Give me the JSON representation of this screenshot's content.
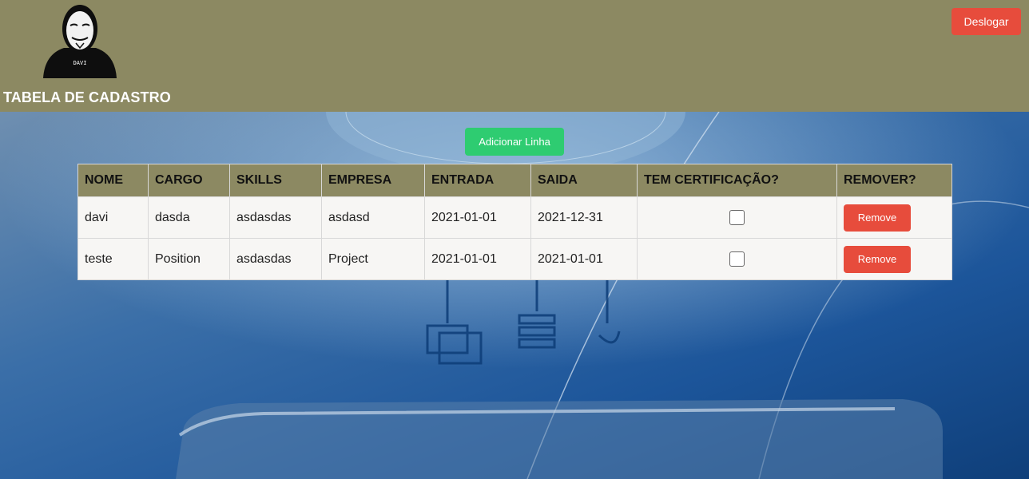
{
  "header": {
    "avatar_label": "DAVI",
    "title": "TABELA DE CADASTRO",
    "logout_label": "Deslogar"
  },
  "toolbar": {
    "add_row_label": "Adicionar Linha"
  },
  "table": {
    "columns": [
      "NOME",
      "CARGO",
      "SKILLS",
      "EMPRESA",
      "ENTRADA",
      "SAIDA",
      "TEM CERTIFICAÇÃO?",
      "REMOVER?"
    ],
    "rows": [
      {
        "nome": "davi",
        "cargo": "dasda",
        "skills": "asdasdas",
        "empresa": "asdasd",
        "entrada": "2021-01-01",
        "saida": "2021-12-31",
        "certificado": false,
        "remove_label": "Remove"
      },
      {
        "nome": "teste",
        "cargo": "Position",
        "skills": "asdasdas",
        "empresa": "Project",
        "entrada": "2021-01-01",
        "saida": "2021-01-01",
        "certificado": false,
        "remove_label": "Remove"
      }
    ]
  },
  "colors": {
    "header_bg": "#8c8962",
    "danger": "#e74c3c",
    "success": "#2ecc71"
  }
}
